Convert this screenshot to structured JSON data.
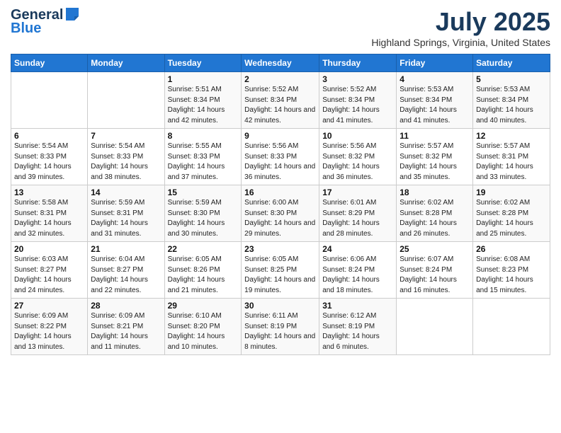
{
  "header": {
    "logo_line1": "General",
    "logo_line2": "Blue",
    "main_title": "July 2025",
    "subtitle": "Highland Springs, Virginia, United States"
  },
  "calendar": {
    "days_of_week": [
      "Sunday",
      "Monday",
      "Tuesday",
      "Wednesday",
      "Thursday",
      "Friday",
      "Saturday"
    ],
    "weeks": [
      [
        {
          "day": "",
          "info": ""
        },
        {
          "day": "",
          "info": ""
        },
        {
          "day": "1",
          "info": "Sunrise: 5:51 AM\nSunset: 8:34 PM\nDaylight: 14 hours and 42 minutes."
        },
        {
          "day": "2",
          "info": "Sunrise: 5:52 AM\nSunset: 8:34 PM\nDaylight: 14 hours and 42 minutes."
        },
        {
          "day": "3",
          "info": "Sunrise: 5:52 AM\nSunset: 8:34 PM\nDaylight: 14 hours and 41 minutes."
        },
        {
          "day": "4",
          "info": "Sunrise: 5:53 AM\nSunset: 8:34 PM\nDaylight: 14 hours and 41 minutes."
        },
        {
          "day": "5",
          "info": "Sunrise: 5:53 AM\nSunset: 8:34 PM\nDaylight: 14 hours and 40 minutes."
        }
      ],
      [
        {
          "day": "6",
          "info": "Sunrise: 5:54 AM\nSunset: 8:33 PM\nDaylight: 14 hours and 39 minutes."
        },
        {
          "day": "7",
          "info": "Sunrise: 5:54 AM\nSunset: 8:33 PM\nDaylight: 14 hours and 38 minutes."
        },
        {
          "day": "8",
          "info": "Sunrise: 5:55 AM\nSunset: 8:33 PM\nDaylight: 14 hours and 37 minutes."
        },
        {
          "day": "9",
          "info": "Sunrise: 5:56 AM\nSunset: 8:33 PM\nDaylight: 14 hours and 36 minutes."
        },
        {
          "day": "10",
          "info": "Sunrise: 5:56 AM\nSunset: 8:32 PM\nDaylight: 14 hours and 36 minutes."
        },
        {
          "day": "11",
          "info": "Sunrise: 5:57 AM\nSunset: 8:32 PM\nDaylight: 14 hours and 35 minutes."
        },
        {
          "day": "12",
          "info": "Sunrise: 5:57 AM\nSunset: 8:31 PM\nDaylight: 14 hours and 33 minutes."
        }
      ],
      [
        {
          "day": "13",
          "info": "Sunrise: 5:58 AM\nSunset: 8:31 PM\nDaylight: 14 hours and 32 minutes."
        },
        {
          "day": "14",
          "info": "Sunrise: 5:59 AM\nSunset: 8:31 PM\nDaylight: 14 hours and 31 minutes."
        },
        {
          "day": "15",
          "info": "Sunrise: 5:59 AM\nSunset: 8:30 PM\nDaylight: 14 hours and 30 minutes."
        },
        {
          "day": "16",
          "info": "Sunrise: 6:00 AM\nSunset: 8:30 PM\nDaylight: 14 hours and 29 minutes."
        },
        {
          "day": "17",
          "info": "Sunrise: 6:01 AM\nSunset: 8:29 PM\nDaylight: 14 hours and 28 minutes."
        },
        {
          "day": "18",
          "info": "Sunrise: 6:02 AM\nSunset: 8:28 PM\nDaylight: 14 hours and 26 minutes."
        },
        {
          "day": "19",
          "info": "Sunrise: 6:02 AM\nSunset: 8:28 PM\nDaylight: 14 hours and 25 minutes."
        }
      ],
      [
        {
          "day": "20",
          "info": "Sunrise: 6:03 AM\nSunset: 8:27 PM\nDaylight: 14 hours and 24 minutes."
        },
        {
          "day": "21",
          "info": "Sunrise: 6:04 AM\nSunset: 8:27 PM\nDaylight: 14 hours and 22 minutes."
        },
        {
          "day": "22",
          "info": "Sunrise: 6:05 AM\nSunset: 8:26 PM\nDaylight: 14 hours and 21 minutes."
        },
        {
          "day": "23",
          "info": "Sunrise: 6:05 AM\nSunset: 8:25 PM\nDaylight: 14 hours and 19 minutes."
        },
        {
          "day": "24",
          "info": "Sunrise: 6:06 AM\nSunset: 8:24 PM\nDaylight: 14 hours and 18 minutes."
        },
        {
          "day": "25",
          "info": "Sunrise: 6:07 AM\nSunset: 8:24 PM\nDaylight: 14 hours and 16 minutes."
        },
        {
          "day": "26",
          "info": "Sunrise: 6:08 AM\nSunset: 8:23 PM\nDaylight: 14 hours and 15 minutes."
        }
      ],
      [
        {
          "day": "27",
          "info": "Sunrise: 6:09 AM\nSunset: 8:22 PM\nDaylight: 14 hours and 13 minutes."
        },
        {
          "day": "28",
          "info": "Sunrise: 6:09 AM\nSunset: 8:21 PM\nDaylight: 14 hours and 11 minutes."
        },
        {
          "day": "29",
          "info": "Sunrise: 6:10 AM\nSunset: 8:20 PM\nDaylight: 14 hours and 10 minutes."
        },
        {
          "day": "30",
          "info": "Sunrise: 6:11 AM\nSunset: 8:19 PM\nDaylight: 14 hours and 8 minutes."
        },
        {
          "day": "31",
          "info": "Sunrise: 6:12 AM\nSunset: 8:19 PM\nDaylight: 14 hours and 6 minutes."
        },
        {
          "day": "",
          "info": ""
        },
        {
          "day": "",
          "info": ""
        }
      ]
    ]
  }
}
